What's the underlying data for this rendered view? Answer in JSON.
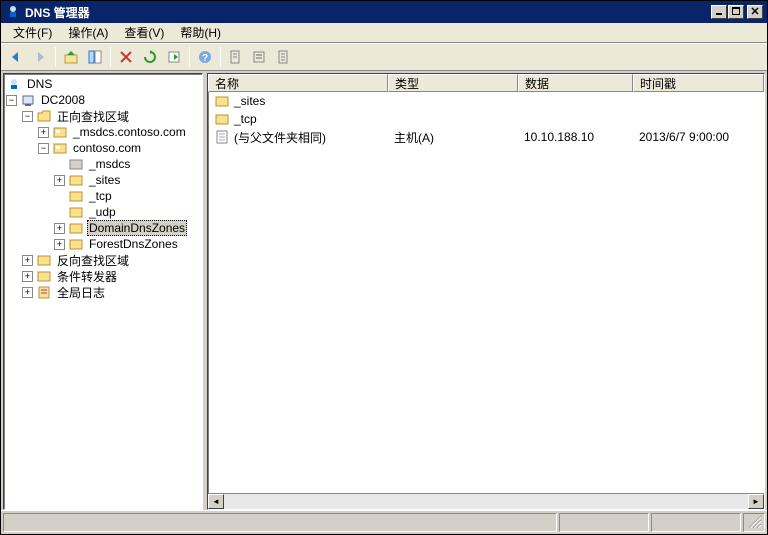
{
  "title": "DNS 管理器",
  "menu": {
    "file": "文件(F)",
    "action": "操作(A)",
    "view": "查看(V)",
    "help": "帮助(H)"
  },
  "tree": {
    "root": "DNS",
    "server": "DC2008",
    "fwd_zone": "正向查找区域",
    "zone1": "_msdcs.contoso.com",
    "zone2": "contoso.com",
    "msdcs": "_msdcs",
    "sites": "_sites",
    "tcp": "_tcp",
    "udp": "_udp",
    "domain_dns": "DomainDnsZones",
    "forest_dns": "ForestDnsZones",
    "rev_zone": "反向查找区域",
    "cond_fwd": "条件转发器",
    "global_log": "全局日志"
  },
  "columns": {
    "name": "名称",
    "type": "类型",
    "data": "数据",
    "timestamp": "时间戳"
  },
  "rows": [
    {
      "icon": "folder",
      "name": "_sites",
      "type": "",
      "data": "",
      "timestamp": ""
    },
    {
      "icon": "folder",
      "name": "_tcp",
      "type": "",
      "data": "",
      "timestamp": ""
    },
    {
      "icon": "record",
      "name": "(与父文件夹相同)",
      "type": "主机(A)",
      "data": "10.10.188.10",
      "timestamp": "2013/6/7 9:00:00"
    }
  ],
  "col_widths": {
    "name": "180px",
    "type": "130px",
    "data": "115px",
    "timestamp": "130px"
  }
}
